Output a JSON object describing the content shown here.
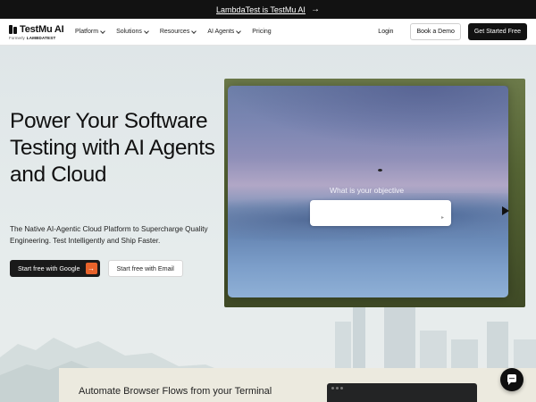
{
  "banner": {
    "text": "LambdaTest is TestMu AI",
    "arrow": "→"
  },
  "nav": {
    "logo_name": "TestMu AI",
    "logo_formerly": "Formerly",
    "logo_formerly_brand": "LAMBDATEST",
    "menu": [
      {
        "label": "Platform"
      },
      {
        "label": "Solutions"
      },
      {
        "label": "Resources"
      },
      {
        "label": "AI Agents"
      },
      {
        "label": "Pricing"
      }
    ],
    "login": "Login",
    "book_demo": "Book a Demo",
    "get_started": "Get Started Free"
  },
  "hero": {
    "title": "Power Your Software Testing with AI Agents and Cloud",
    "subtitle": "The Native AI-Agentic Cloud Platform to Supercharge Quality Engineering. Test Intelligently and Ship Faster.",
    "cta_google": "Start free with Google",
    "cta_google_arrow": "→",
    "cta_email": "Start free with Email",
    "objective_prompt": "What is your objective"
  },
  "bottom": {
    "title": "Automate Browser Flows from your Terminal"
  },
  "colors": {
    "accent": "#e8632b",
    "dark": "#121212"
  }
}
